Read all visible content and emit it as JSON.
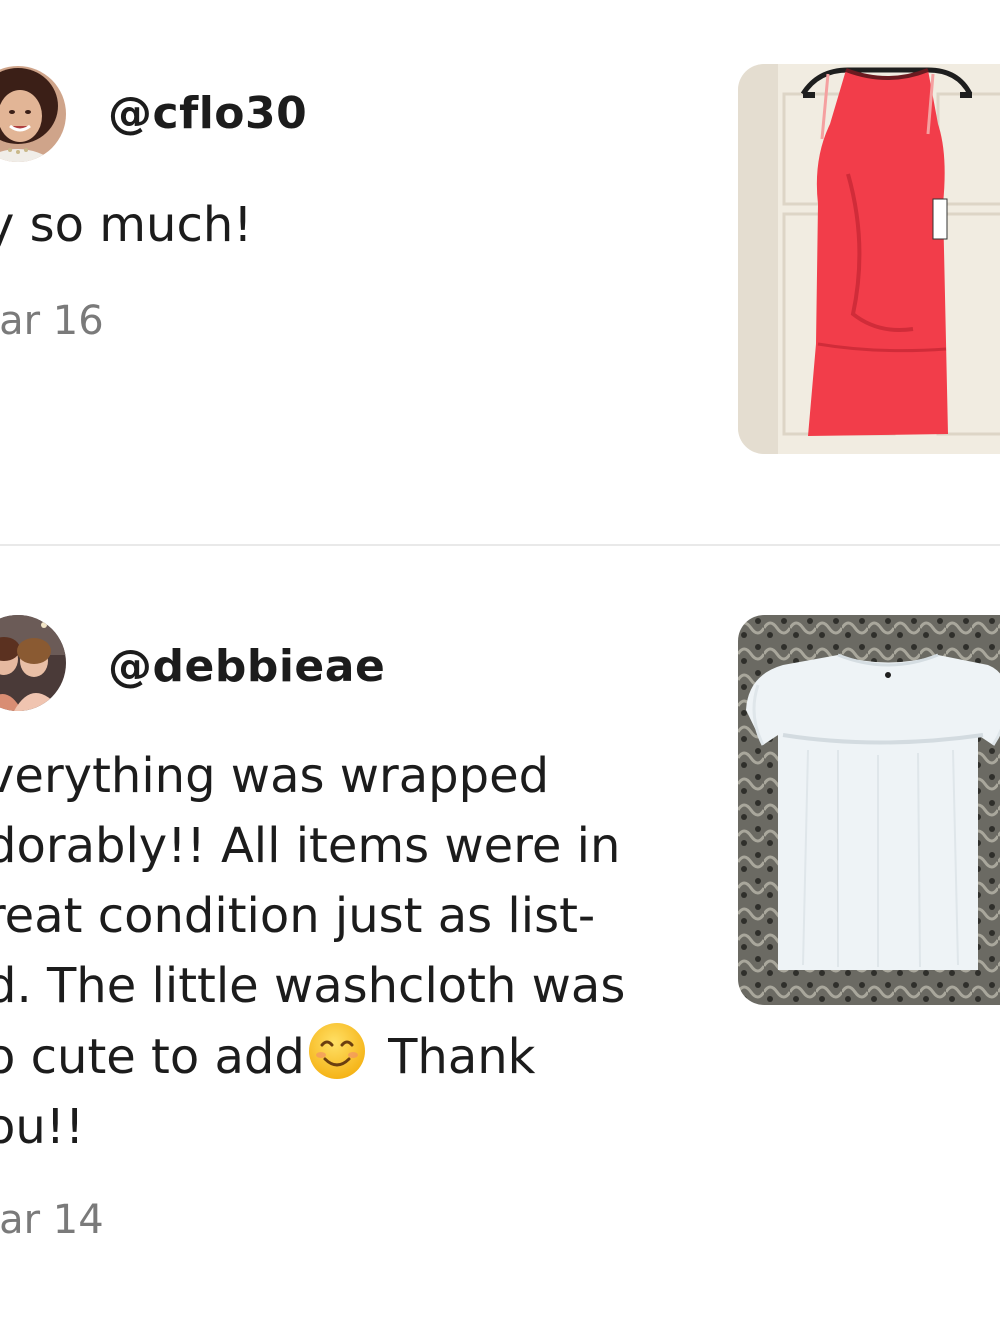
{
  "reviews": [
    {
      "username": "@cflo30",
      "comment": "y so much!",
      "date": "lar 16",
      "product": "red-dress"
    },
    {
      "username": "@debbieae",
      "comment_lines": [
        "verything was wrapped",
        "dorably!! All items were in",
        "reat condition just as list-",
        "d. The little washcloth was"
      ],
      "comment_line5_before": "o cute to add",
      "emoji": "smiling-face-emoji",
      "comment_line5_after": " Thank",
      "comment_line6": "ou!!",
      "date": "lar 14",
      "product": "white-blouse"
    }
  ],
  "colors": {
    "text": "#1c1c1c",
    "date": "#7a7a7a",
    "divider": "#e9e9e9",
    "dress": "#f23d4a",
    "door": "#f1ece1"
  }
}
